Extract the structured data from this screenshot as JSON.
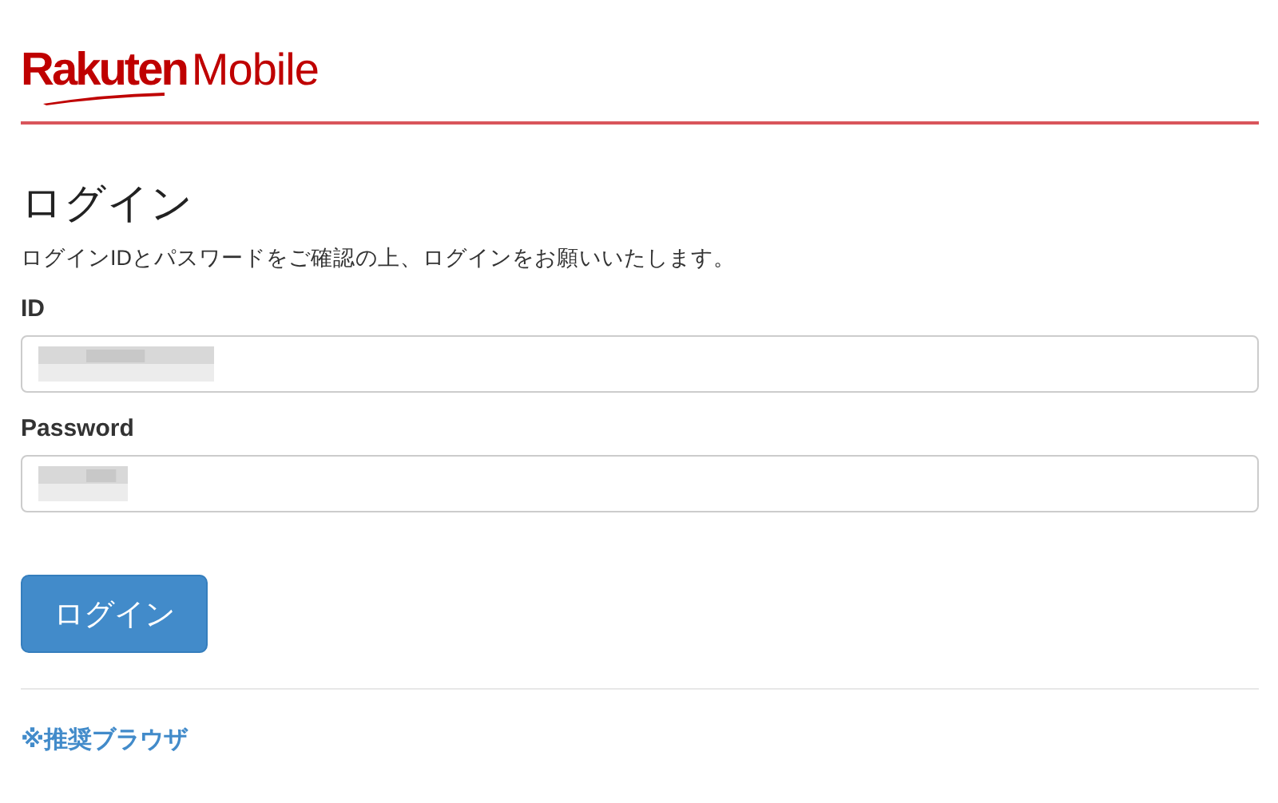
{
  "logo": {
    "brand": "Rakuten",
    "product": "Mobile"
  },
  "heading": "ログイン",
  "description": "ログインIDとパスワードをご確認の上、ログインをお願いいたします。",
  "fields": [
    {
      "label": "ID",
      "redacted": true,
      "redacted_long": true
    },
    {
      "label": "Password",
      "redacted": true,
      "redacted_long": false
    }
  ],
  "login_button": "ログイン",
  "recommended_browsers_link": "※推奨ブラウザ"
}
